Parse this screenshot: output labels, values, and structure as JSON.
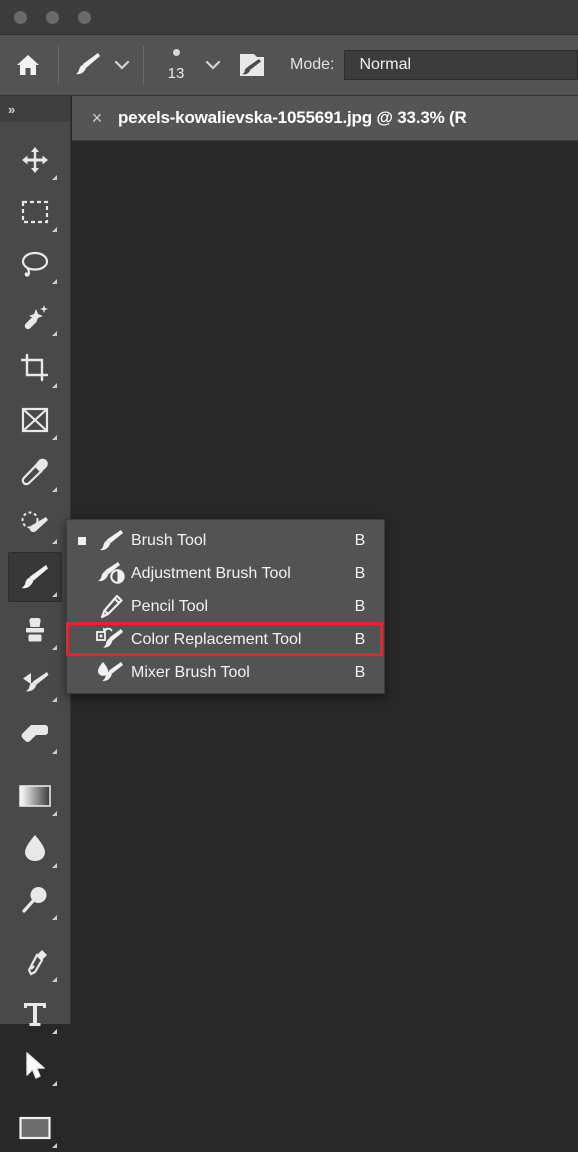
{
  "window": {
    "traffic_lights": [
      "close",
      "minimize",
      "zoom"
    ]
  },
  "options_bar": {
    "home_icon": "home-icon",
    "brush_preset_icon": "brush-icon",
    "brush_preset_chevron": "chevron-down-icon",
    "brush_size_value": "13",
    "brush_size_chevron": "chevron-down-icon",
    "brush_settings_icon": "brush-settings-panel-icon",
    "mode_label": "Mode:",
    "mode_value": "Normal"
  },
  "document_tab": {
    "close_glyph": "×",
    "title": "pexels-kowalievska-1055691.jpg @ 33.3% (R"
  },
  "toolbar": {
    "expand_glyph": "»",
    "tools": [
      {
        "name": "move-tool",
        "active": false
      },
      {
        "name": "rectangular-marquee-tool",
        "active": false
      },
      {
        "name": "lasso-tool",
        "active": false
      },
      {
        "name": "object-selection-tool",
        "active": false
      },
      {
        "name": "crop-tool",
        "active": false
      },
      {
        "name": "frame-tool",
        "active": false
      },
      {
        "name": "eyedropper-tool",
        "active": false
      },
      {
        "name": "spot-healing-brush-tool",
        "active": false
      },
      {
        "name": "brush-tool",
        "active": true
      },
      {
        "name": "clone-stamp-tool",
        "active": false
      },
      {
        "name": "history-brush-tool",
        "active": false
      },
      {
        "name": "eraser-tool",
        "active": false
      },
      {
        "name": "gradient-tool",
        "active": false
      },
      {
        "name": "blur-tool",
        "active": false
      },
      {
        "name": "dodge-tool",
        "active": false
      },
      {
        "name": "pen-tool",
        "active": false
      },
      {
        "name": "type-tool",
        "active": false
      },
      {
        "name": "path-selection-tool",
        "active": false
      },
      {
        "name": "rectangle-tool",
        "active": false
      }
    ]
  },
  "flyout_menu": {
    "items": [
      {
        "label": "Brush Tool",
        "shortcut": "B",
        "selected": true,
        "highlighted": false
      },
      {
        "label": "Adjustment Brush Tool",
        "shortcut": "B",
        "selected": false,
        "highlighted": false
      },
      {
        "label": "Pencil Tool",
        "shortcut": "B",
        "selected": false,
        "highlighted": false
      },
      {
        "label": "Color Replacement Tool",
        "shortcut": "B",
        "selected": false,
        "highlighted": true
      },
      {
        "label": "Mixer Brush Tool",
        "shortcut": "B",
        "selected": false,
        "highlighted": false
      }
    ]
  },
  "annotation": {
    "highlight_color": "#e3262b",
    "target": "Color Replacement Tool"
  },
  "colors": {
    "canvas_background": "#282828",
    "toolbar_background": "#494949",
    "options_bar_background": "#535353",
    "menu_background": "#535353",
    "tab_background": "#555555",
    "accent_red": "#e3262b"
  }
}
